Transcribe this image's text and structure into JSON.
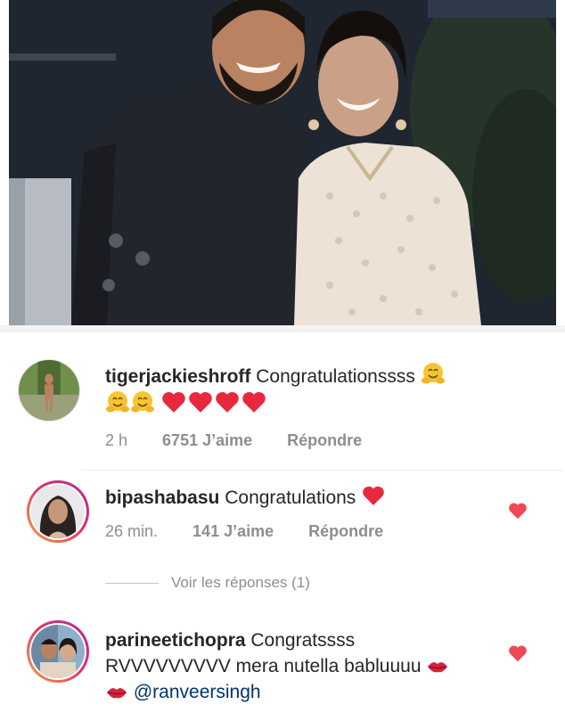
{
  "post": {
    "photo_icon": "couple-photo"
  },
  "comments": [
    {
      "username": "tigerjackieshroff",
      "text": "Congratulationssss",
      "emoji_line": "hug-emoji x3, red-heart x4",
      "time": "2 h",
      "likes": "6751 J’aime",
      "reply": "Répondre"
    },
    {
      "username": "bipashabasu",
      "text": "Congratulations",
      "time": "26 min.",
      "likes": "141 J’aime",
      "reply": "Répondre",
      "view_replies": "Voir les réponses (1)"
    },
    {
      "username": "parineetichopra",
      "text": "Congratssss",
      "line2": "RVVVVVVVVV mera nutella babluuuu",
      "mention": "@ranveersingh"
    }
  ],
  "colors": {
    "heart": "#ed4956",
    "meta": "#8e8e8e",
    "text": "#262626",
    "mention": "#003569"
  }
}
